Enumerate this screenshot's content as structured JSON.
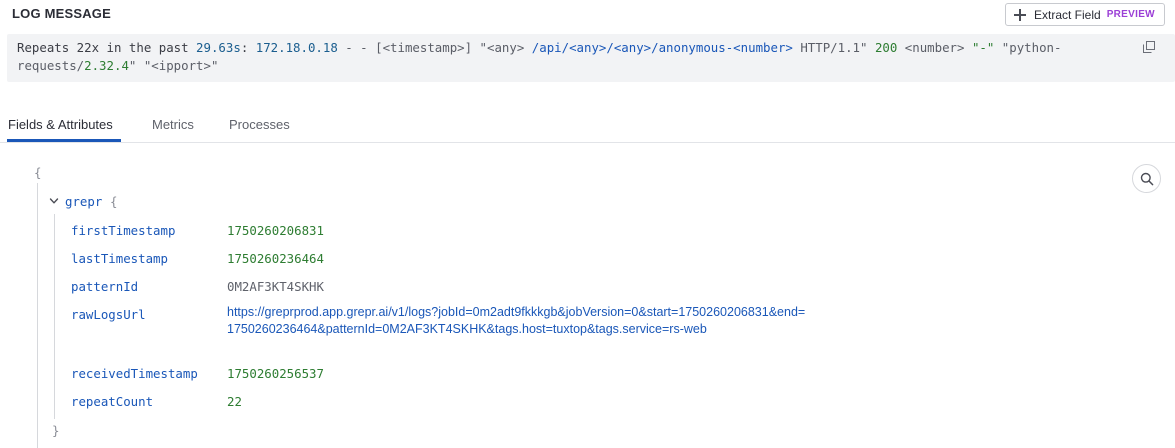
{
  "header": {
    "title": "LOG MESSAGE",
    "extract_button": {
      "label": "Extract Field",
      "badge": "PREVIEW"
    }
  },
  "log_message": {
    "prefix": "Repeats 22x in the past ",
    "duration": "29.63s",
    "colon": ": ",
    "ip": "172.18.0.18",
    "dash1": " - - [",
    "timestamp_token": "<timestamp>",
    "after_ts": "] ",
    "any_quoted": "\"<any>",
    "path": " /api/<any>/<any>/anonymous-<number>",
    "http": " HTTP/1.1\" ",
    "status": "200",
    "number_token": " <number> ",
    "dash_str": "\"-\"",
    "agent_open": " \"python-requests/",
    "agent_version": "2.32.4",
    "agent_close": "\" ",
    "ipport": "\"<ipport>\""
  },
  "tabs": [
    {
      "label": "Fields & Attributes",
      "active": true
    },
    {
      "label": "Metrics",
      "active": false
    },
    {
      "label": "Processes",
      "active": false
    }
  ],
  "json_view": {
    "open_brace": "{",
    "close_brace": "}",
    "group_key": "grepr",
    "group_brace": "{",
    "group_close": "}",
    "fields": {
      "firstTimestamp": {
        "key": "firstTimestamp",
        "value": "1750260206831"
      },
      "lastTimestamp": {
        "key": "lastTimestamp",
        "value": "1750260236464"
      },
      "patternId": {
        "key": "patternId",
        "value": "0M2AF3KT4SKHK"
      },
      "rawLogsUrl": {
        "key": "rawLogsUrl",
        "value": "https://greprprod.app.grepr.ai/v1/logs?jobId=0m2adt9fkkkgb&jobVersion=0&start=1750260206831&end=1750260236464&patternId=0M2AF3KT4SKHK&tags.host=tuxtop&tags.service=rs-web"
      },
      "receivedTimestamp": {
        "key": "receivedTimestamp",
        "value": "1750260256537"
      },
      "repeatCount": {
        "key": "repeatCount",
        "value": "22"
      }
    }
  },
  "icons": {
    "extract": "plus-icon",
    "copy": "copy-icon",
    "search": "search-icon",
    "collapse": "chevron-down-icon"
  },
  "colors": {
    "accent": "#1a57b8",
    "number": "#2e7d32",
    "badge": "#9b3fd6"
  }
}
